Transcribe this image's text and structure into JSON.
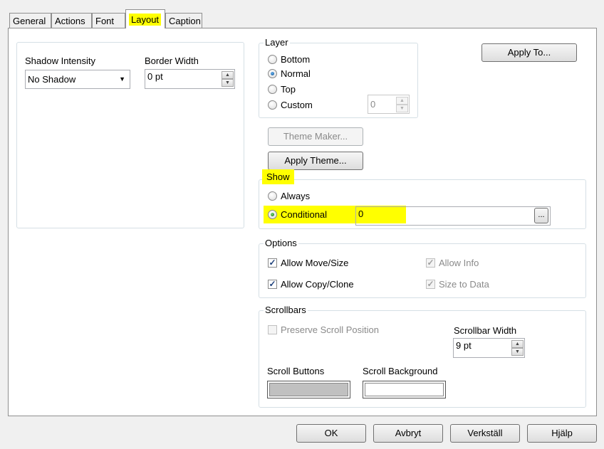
{
  "tabs": [
    "General",
    "Actions",
    "Font",
    "Layout",
    "Caption"
  ],
  "active_tab": "Layout",
  "shadow": {
    "label": "Shadow Intensity",
    "value": "No Shadow"
  },
  "border": {
    "label": "Border Width",
    "value": "0 pt"
  },
  "layer": {
    "title": "Layer",
    "options": [
      "Bottom",
      "Normal",
      "Top",
      "Custom"
    ],
    "selected": "Normal",
    "custom_value": "0"
  },
  "apply_to_label": "Apply To...",
  "theme_maker_label": "Theme Maker...",
  "apply_theme_label": "Apply Theme...",
  "show": {
    "title": "Show",
    "always_label": "Always",
    "conditional_label": "Conditional",
    "selected": "Conditional",
    "condition_value": "0",
    "ellipsis_label": "..."
  },
  "options": {
    "title": "Options",
    "allow_move_size": "Allow Move/Size",
    "allow_copy_clone": "Allow Copy/Clone",
    "allow_info": "Allow Info",
    "size_to_data": "Size to Data"
  },
  "scrollbars": {
    "title": "Scrollbars",
    "preserve_label": "Preserve Scroll Position",
    "width_label": "Scrollbar Width",
    "width_value": "9 pt",
    "buttons_label": "Scroll Buttons",
    "background_label": "Scroll Background",
    "buttons_color": "#c0c0c0",
    "background_color": "#ffffff"
  },
  "footer": {
    "ok": "OK",
    "cancel": "Avbryt",
    "apply": "Verkställ",
    "help": "Hjälp"
  },
  "colors": {
    "highlight": "#ffff00"
  }
}
